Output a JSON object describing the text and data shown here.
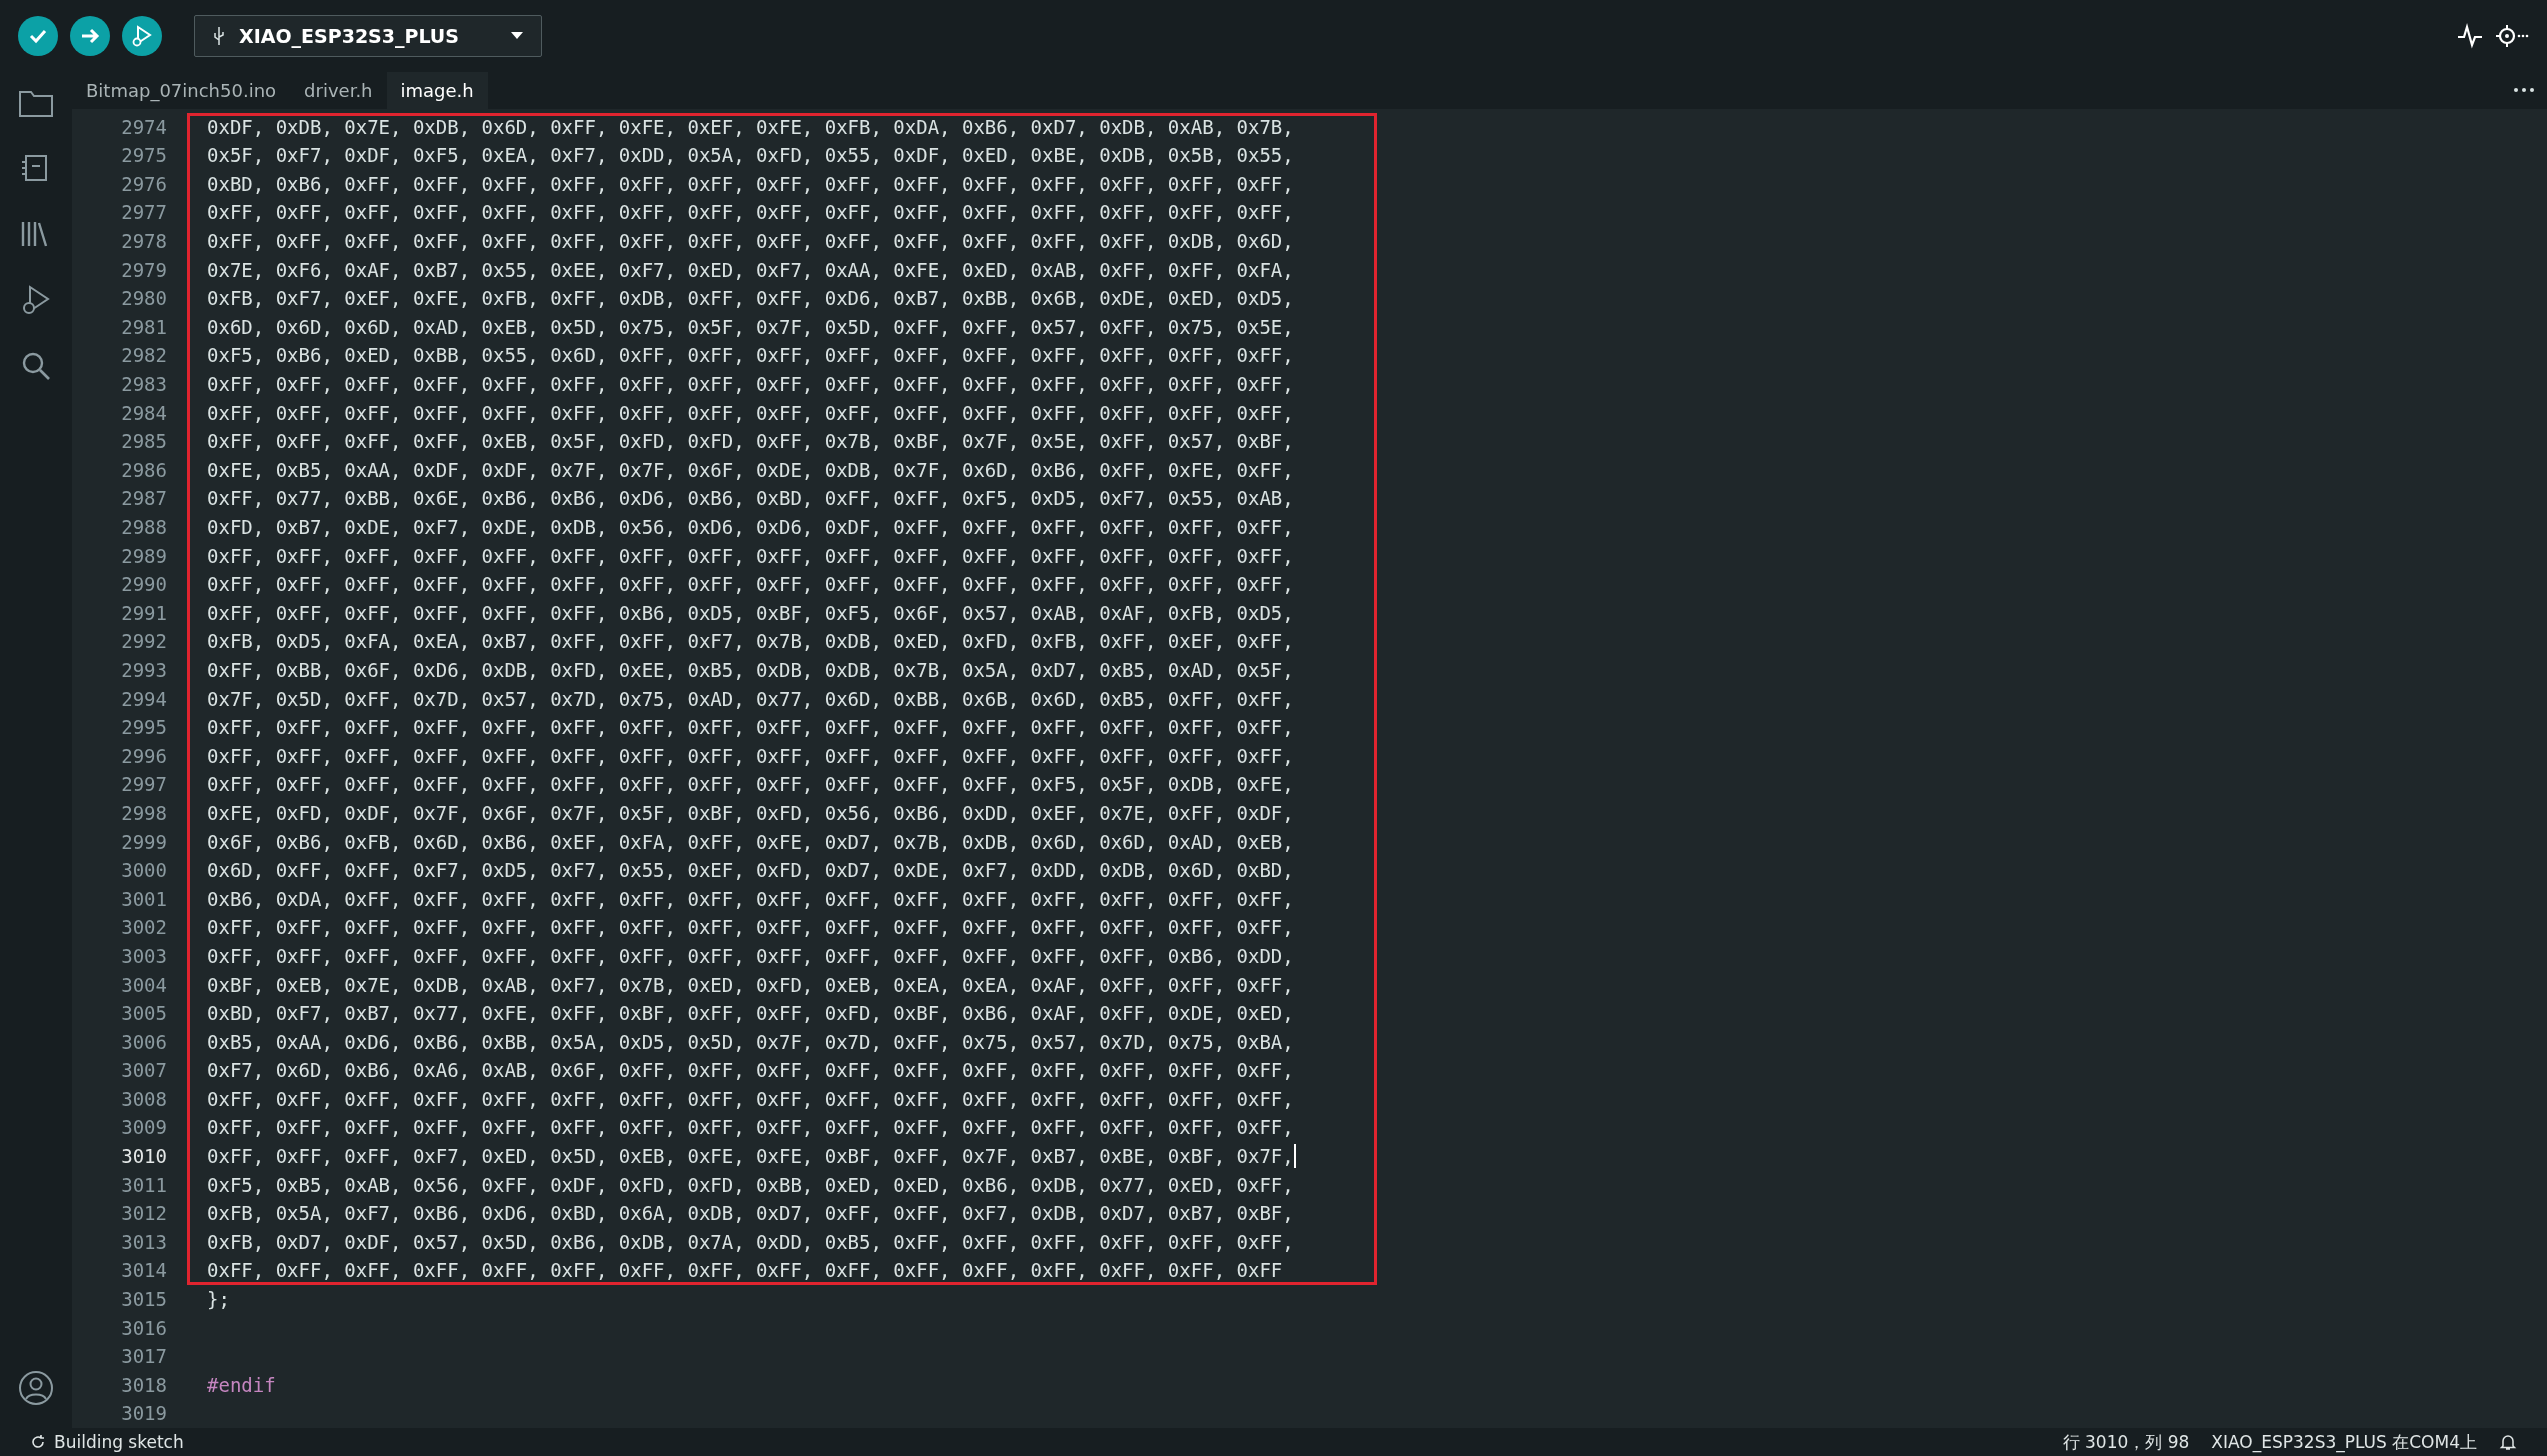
{
  "toolbar": {
    "buttons": [
      {
        "kind": "verify"
      },
      {
        "kind": "upload"
      },
      {
        "kind": "debug"
      }
    ],
    "board": "XIAO_ESP32S3_PLUS"
  },
  "tabs": [
    {
      "label": "Bitmap_07inch50.ino",
      "selected": false
    },
    {
      "label": "driver.h",
      "selected": false
    },
    {
      "label": "image.h",
      "selected": true
    }
  ],
  "editor": {
    "lines": [
      {
        "number": "2974",
        "text": "0xDF, 0xDB, 0x7E, 0xDB, 0x6D, 0xFF, 0xFE, 0xEF, 0xFE, 0xFB, 0xDA, 0xB6, 0xD7, 0xDB, 0xAB, 0x7B,",
        "highlighted": true,
        "current": false,
        "kind": "code"
      },
      {
        "number": "2975",
        "text": "0x5F, 0xF7, 0xDF, 0xF5, 0xEA, 0xF7, 0xDD, 0x5A, 0xFD, 0x55, 0xDF, 0xED, 0xBE, 0xDB, 0x5B, 0x55,",
        "highlighted": true,
        "current": false,
        "kind": "code"
      },
      {
        "number": "2976",
        "text": "0xBD, 0xB6, 0xFF, 0xFF, 0xFF, 0xFF, 0xFF, 0xFF, 0xFF, 0xFF, 0xFF, 0xFF, 0xFF, 0xFF, 0xFF, 0xFF,",
        "highlighted": true,
        "current": false,
        "kind": "code"
      },
      {
        "number": "2977",
        "text": "0xFF, 0xFF, 0xFF, 0xFF, 0xFF, 0xFF, 0xFF, 0xFF, 0xFF, 0xFF, 0xFF, 0xFF, 0xFF, 0xFF, 0xFF, 0xFF,",
        "highlighted": true,
        "current": false,
        "kind": "code"
      },
      {
        "number": "2978",
        "text": "0xFF, 0xFF, 0xFF, 0xFF, 0xFF, 0xFF, 0xFF, 0xFF, 0xFF, 0xFF, 0xFF, 0xFF, 0xFF, 0xFF, 0xDB, 0x6D,",
        "highlighted": true,
        "current": false,
        "kind": "code"
      },
      {
        "number": "2979",
        "text": "0x7E, 0xF6, 0xAF, 0xB7, 0x55, 0xEE, 0xF7, 0xED, 0xF7, 0xAA, 0xFE, 0xED, 0xAB, 0xFF, 0xFF, 0xFA,",
        "highlighted": true,
        "current": false,
        "kind": "code"
      },
      {
        "number": "2980",
        "text": "0xFB, 0xF7, 0xEF, 0xFE, 0xFB, 0xFF, 0xDB, 0xFF, 0xFF, 0xD6, 0xB7, 0xBB, 0x6B, 0xDE, 0xED, 0xD5,",
        "highlighted": true,
        "current": false,
        "kind": "code"
      },
      {
        "number": "2981",
        "text": "0x6D, 0x6D, 0x6D, 0xAD, 0xEB, 0x5D, 0x75, 0x5F, 0x7F, 0x5D, 0xFF, 0xFF, 0x57, 0xFF, 0x75, 0x5E,",
        "highlighted": true,
        "current": false,
        "kind": "code"
      },
      {
        "number": "2982",
        "text": "0xF5, 0xB6, 0xED, 0xBB, 0x55, 0x6D, 0xFF, 0xFF, 0xFF, 0xFF, 0xFF, 0xFF, 0xFF, 0xFF, 0xFF, 0xFF,",
        "highlighted": true,
        "current": false,
        "kind": "code"
      },
      {
        "number": "2983",
        "text": "0xFF, 0xFF, 0xFF, 0xFF, 0xFF, 0xFF, 0xFF, 0xFF, 0xFF, 0xFF, 0xFF, 0xFF, 0xFF, 0xFF, 0xFF, 0xFF,",
        "highlighted": true,
        "current": false,
        "kind": "code"
      },
      {
        "number": "2984",
        "text": "0xFF, 0xFF, 0xFF, 0xFF, 0xFF, 0xFF, 0xFF, 0xFF, 0xFF, 0xFF, 0xFF, 0xFF, 0xFF, 0xFF, 0xFF, 0xFF,",
        "highlighted": true,
        "current": false,
        "kind": "code"
      },
      {
        "number": "2985",
        "text": "0xFF, 0xFF, 0xFF, 0xFF, 0xEB, 0x5F, 0xFD, 0xFD, 0xFF, 0x7B, 0xBF, 0x7F, 0x5E, 0xFF, 0x57, 0xBF,",
        "highlighted": true,
        "current": false,
        "kind": "code"
      },
      {
        "number": "2986",
        "text": "0xFE, 0xB5, 0xAA, 0xDF, 0xDF, 0x7F, 0x7F, 0x6F, 0xDE, 0xDB, 0x7F, 0x6D, 0xB6, 0xFF, 0xFE, 0xFF,",
        "highlighted": true,
        "current": false,
        "kind": "code"
      },
      {
        "number": "2987",
        "text": "0xFF, 0x77, 0xBB, 0x6E, 0xB6, 0xB6, 0xD6, 0xB6, 0xBD, 0xFF, 0xFF, 0xF5, 0xD5, 0xF7, 0x55, 0xAB,",
        "highlighted": true,
        "current": false,
        "kind": "code"
      },
      {
        "number": "2988",
        "text": "0xFD, 0xB7, 0xDE, 0xF7, 0xDE, 0xDB, 0x56, 0xD6, 0xD6, 0xDF, 0xFF, 0xFF, 0xFF, 0xFF, 0xFF, 0xFF,",
        "highlighted": true,
        "current": false,
        "kind": "code"
      },
      {
        "number": "2989",
        "text": "0xFF, 0xFF, 0xFF, 0xFF, 0xFF, 0xFF, 0xFF, 0xFF, 0xFF, 0xFF, 0xFF, 0xFF, 0xFF, 0xFF, 0xFF, 0xFF,",
        "highlighted": true,
        "current": false,
        "kind": "code"
      },
      {
        "number": "2990",
        "text": "0xFF, 0xFF, 0xFF, 0xFF, 0xFF, 0xFF, 0xFF, 0xFF, 0xFF, 0xFF, 0xFF, 0xFF, 0xFF, 0xFF, 0xFF, 0xFF,",
        "highlighted": true,
        "current": false,
        "kind": "code"
      },
      {
        "number": "2991",
        "text": "0xFF, 0xFF, 0xFF, 0xFF, 0xFF, 0xFF, 0xB6, 0xD5, 0xBF, 0xF5, 0x6F, 0x57, 0xAB, 0xAF, 0xFB, 0xD5,",
        "highlighted": true,
        "current": false,
        "kind": "code"
      },
      {
        "number": "2992",
        "text": "0xFB, 0xD5, 0xFA, 0xEA, 0xB7, 0xFF, 0xFF, 0xF7, 0x7B, 0xDB, 0xED, 0xFD, 0xFB, 0xFF, 0xEF, 0xFF,",
        "highlighted": true,
        "current": false,
        "kind": "code"
      },
      {
        "number": "2993",
        "text": "0xFF, 0xBB, 0x6F, 0xD6, 0xDB, 0xFD, 0xEE, 0xB5, 0xDB, 0xDB, 0x7B, 0x5A, 0xD7, 0xB5, 0xAD, 0x5F,",
        "highlighted": true,
        "current": false,
        "kind": "code"
      },
      {
        "number": "2994",
        "text": "0x7F, 0x5D, 0xFF, 0x7D, 0x57, 0x7D, 0x75, 0xAD, 0x77, 0x6D, 0xBB, 0x6B, 0x6D, 0xB5, 0xFF, 0xFF,",
        "highlighted": true,
        "current": false,
        "kind": "code"
      },
      {
        "number": "2995",
        "text": "0xFF, 0xFF, 0xFF, 0xFF, 0xFF, 0xFF, 0xFF, 0xFF, 0xFF, 0xFF, 0xFF, 0xFF, 0xFF, 0xFF, 0xFF, 0xFF,",
        "highlighted": true,
        "current": false,
        "kind": "code"
      },
      {
        "number": "2996",
        "text": "0xFF, 0xFF, 0xFF, 0xFF, 0xFF, 0xFF, 0xFF, 0xFF, 0xFF, 0xFF, 0xFF, 0xFF, 0xFF, 0xFF, 0xFF, 0xFF,",
        "highlighted": true,
        "current": false,
        "kind": "code"
      },
      {
        "number": "2997",
        "text": "0xFF, 0xFF, 0xFF, 0xFF, 0xFF, 0xFF, 0xFF, 0xFF, 0xFF, 0xFF, 0xFF, 0xFF, 0xF5, 0x5F, 0xDB, 0xFE,",
        "highlighted": true,
        "current": false,
        "kind": "code"
      },
      {
        "number": "2998",
        "text": "0xFE, 0xFD, 0xDF, 0x7F, 0x6F, 0x7F, 0x5F, 0xBF, 0xFD, 0x56, 0xB6, 0xDD, 0xEF, 0x7E, 0xFF, 0xDF,",
        "highlighted": true,
        "current": false,
        "kind": "code"
      },
      {
        "number": "2999",
        "text": "0x6F, 0xB6, 0xFB, 0x6D, 0xB6, 0xEF, 0xFA, 0xFF, 0xFE, 0xD7, 0x7B, 0xDB, 0x6D, 0x6D, 0xAD, 0xEB,",
        "highlighted": true,
        "current": false,
        "kind": "code"
      },
      {
        "number": "3000",
        "text": "0x6D, 0xFF, 0xFF, 0xF7, 0xD5, 0xF7, 0x55, 0xEF, 0xFD, 0xD7, 0xDE, 0xF7, 0xDD, 0xDB, 0x6D, 0xBD,",
        "highlighted": true,
        "current": false,
        "kind": "code"
      },
      {
        "number": "3001",
        "text": "0xB6, 0xDA, 0xFF, 0xFF, 0xFF, 0xFF, 0xFF, 0xFF, 0xFF, 0xFF, 0xFF, 0xFF, 0xFF, 0xFF, 0xFF, 0xFF,",
        "highlighted": true,
        "current": false,
        "kind": "code"
      },
      {
        "number": "3002",
        "text": "0xFF, 0xFF, 0xFF, 0xFF, 0xFF, 0xFF, 0xFF, 0xFF, 0xFF, 0xFF, 0xFF, 0xFF, 0xFF, 0xFF, 0xFF, 0xFF,",
        "highlighted": true,
        "current": false,
        "kind": "code"
      },
      {
        "number": "3003",
        "text": "0xFF, 0xFF, 0xFF, 0xFF, 0xFF, 0xFF, 0xFF, 0xFF, 0xFF, 0xFF, 0xFF, 0xFF, 0xFF, 0xFF, 0xB6, 0xDD,",
        "highlighted": true,
        "current": false,
        "kind": "code"
      },
      {
        "number": "3004",
        "text": "0xBF, 0xEB, 0x7E, 0xDB, 0xAB, 0xF7, 0x7B, 0xED, 0xFD, 0xEB, 0xEA, 0xEA, 0xAF, 0xFF, 0xFF, 0xFF,",
        "highlighted": true,
        "current": false,
        "kind": "code"
      },
      {
        "number": "3005",
        "text": "0xBD, 0xF7, 0xB7, 0x77, 0xFE, 0xFF, 0xBF, 0xFF, 0xFF, 0xFD, 0xBF, 0xB6, 0xAF, 0xFF, 0xDE, 0xED,",
        "highlighted": true,
        "current": false,
        "kind": "code"
      },
      {
        "number": "3006",
        "text": "0xB5, 0xAA, 0xD6, 0xB6, 0xBB, 0x5A, 0xD5, 0x5D, 0x7F, 0x7D, 0xFF, 0x75, 0x57, 0x7D, 0x75, 0xBA,",
        "highlighted": true,
        "current": false,
        "kind": "code"
      },
      {
        "number": "3007",
        "text": "0xF7, 0x6D, 0xB6, 0xA6, 0xAB, 0x6F, 0xFF, 0xFF, 0xFF, 0xFF, 0xFF, 0xFF, 0xFF, 0xFF, 0xFF, 0xFF,",
        "highlighted": true,
        "current": false,
        "kind": "code"
      },
      {
        "number": "3008",
        "text": "0xFF, 0xFF, 0xFF, 0xFF, 0xFF, 0xFF, 0xFF, 0xFF, 0xFF, 0xFF, 0xFF, 0xFF, 0xFF, 0xFF, 0xFF, 0xFF,",
        "highlighted": true,
        "current": false,
        "kind": "code"
      },
      {
        "number": "3009",
        "text": "0xFF, 0xFF, 0xFF, 0xFF, 0xFF, 0xFF, 0xFF, 0xFF, 0xFF, 0xFF, 0xFF, 0xFF, 0xFF, 0xFF, 0xFF, 0xFF,",
        "highlighted": true,
        "current": false,
        "kind": "code"
      },
      {
        "number": "3010",
        "text": "0xFF, 0xFF, 0xFF, 0xF7, 0xED, 0x5D, 0xEB, 0xFE, 0xFE, 0xBF, 0xFF, 0x7F, 0xB7, 0xBE, 0xBF, 0x7F,",
        "highlighted": true,
        "current": true,
        "kind": "code"
      },
      {
        "number": "3011",
        "text": "0xF5, 0xB5, 0xAB, 0x56, 0xFF, 0xDF, 0xFD, 0xFD, 0xBB, 0xED, 0xED, 0xB6, 0xDB, 0x77, 0xED, 0xFF,",
        "highlighted": true,
        "current": false,
        "kind": "code"
      },
      {
        "number": "3012",
        "text": "0xFB, 0x5A, 0xF7, 0xB6, 0xD6, 0xBD, 0x6A, 0xDB, 0xD7, 0xFF, 0xFF, 0xF7, 0xDB, 0xD7, 0xB7, 0xBF,",
        "highlighted": true,
        "current": false,
        "kind": "code"
      },
      {
        "number": "3013",
        "text": "0xFB, 0xD7, 0xDF, 0x57, 0x5D, 0xB6, 0xDB, 0x7A, 0xDD, 0xB5, 0xFF, 0xFF, 0xFF, 0xFF, 0xFF, 0xFF,",
        "highlighted": true,
        "current": false,
        "kind": "code"
      },
      {
        "number": "3014",
        "text": "0xFF, 0xFF, 0xFF, 0xFF, 0xFF, 0xFF, 0xFF, 0xFF, 0xFF, 0xFF, 0xFF, 0xFF, 0xFF, 0xFF, 0xFF, 0xFF",
        "highlighted": true,
        "current": false,
        "kind": "code"
      },
      {
        "number": "3015",
        "text": "};",
        "highlighted": false,
        "current": false,
        "kind": "code"
      },
      {
        "number": "3016",
        "highlighted": false,
        "current": false,
        "kind": "code"
      },
      {
        "number": "3017",
        "highlighted": false,
        "current": false,
        "kind": "code"
      },
      {
        "number": "3018",
        "text": "#endif",
        "highlighted": false,
        "current": false,
        "kind": "directive"
      },
      {
        "number": "3019",
        "highlighted": false,
        "current": false,
        "kind": "code"
      }
    ]
  },
  "status_bar": {
    "task": "Building sketch",
    "position": "行 3010，列 98",
    "board_port": "XIAO_ESP32S3_PLUS 在COM4上"
  }
}
